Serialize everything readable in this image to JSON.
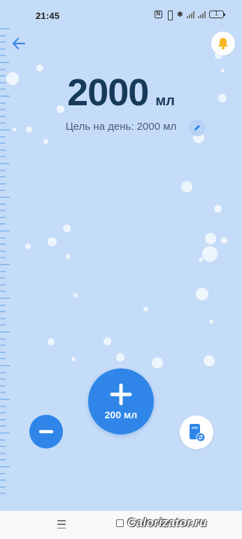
{
  "status_bar": {
    "time": "21:45",
    "nfc": "N",
    "bluetooth": "✱",
    "battery": "1"
  },
  "header": {
    "back_icon": "arrow-left-icon",
    "bell_icon": "bell-icon"
  },
  "counter": {
    "amount": "2000",
    "unit": "мл",
    "goal_label": "Цель на день: 2000 мл",
    "edit_icon": "pencil-icon"
  },
  "controls": {
    "add_label": "200 мл",
    "add_icon": "plus-icon",
    "minus_icon": "minus-icon",
    "drink_icon": "drink-switch-icon"
  },
  "watermark": "Calorizator.ru",
  "colors": {
    "background": "#c5dcf8",
    "accent": "#2f86e8",
    "bell": "#f4b722",
    "text_dark": "#173a5a"
  }
}
